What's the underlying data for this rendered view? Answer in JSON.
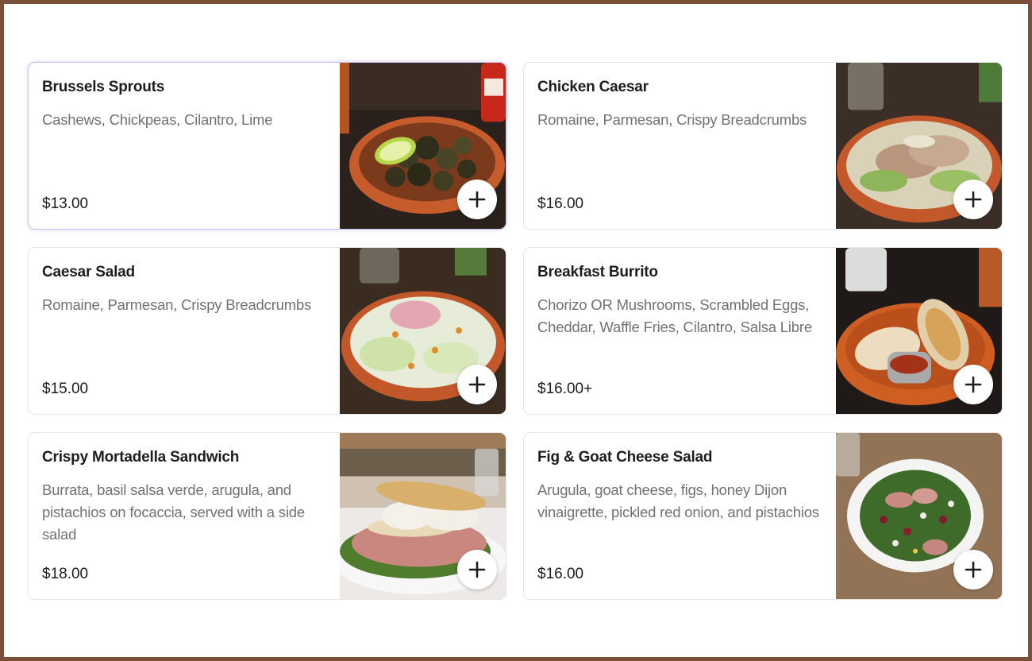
{
  "menu": {
    "items": [
      {
        "title": "Brussels Sprouts",
        "description": "Cashews, Chickpeas, Cilantro, Lime",
        "price": "$13.00",
        "image_icon": "brussels-sprouts-bowl-photo",
        "add_icon": "plus-icon"
      },
      {
        "title": "Chicken Caesar",
        "description": "Romaine, Parmesan, Crispy Breadcrumbs",
        "price": "$16.00",
        "image_icon": "chicken-caesar-bowl-photo",
        "add_icon": "plus-icon"
      },
      {
        "title": "Caesar Salad",
        "description": "Romaine, Parmesan, Crispy Breadcrumbs",
        "price": "$15.00",
        "image_icon": "caesar-salad-bowl-photo",
        "add_icon": "plus-icon"
      },
      {
        "title": "Breakfast Burrito",
        "description": "Chorizo OR Mushrooms, Scrambled Eggs, Cheddar, Waffle Fries, Cilantro, Salsa Libre",
        "price": "$16.00+",
        "image_icon": "breakfast-burrito-bowl-photo",
        "add_icon": "plus-icon"
      },
      {
        "title": "Crispy Mortadella Sandwich",
        "description": "Burrata, basil salsa verde, arugula, and pistachios on focaccia, served with a side salad",
        "price": "$18.00",
        "image_icon": "mortadella-sandwich-photo",
        "add_icon": "plus-icon"
      },
      {
        "title": "Fig & Goat Cheese Salad",
        "description": "Arugula, goat cheese, figs, honey Dijon vinaigrette, pickled red onion, and pistachios",
        "price": "$16.00",
        "image_icon": "fig-goat-cheese-salad-photo",
        "add_icon": "plus-icon"
      }
    ]
  },
  "colors": {
    "frame_border": "#7a5138",
    "title_text": "#1d1d1d",
    "description_text": "#727272",
    "selected_border": "#c8c2f2"
  }
}
